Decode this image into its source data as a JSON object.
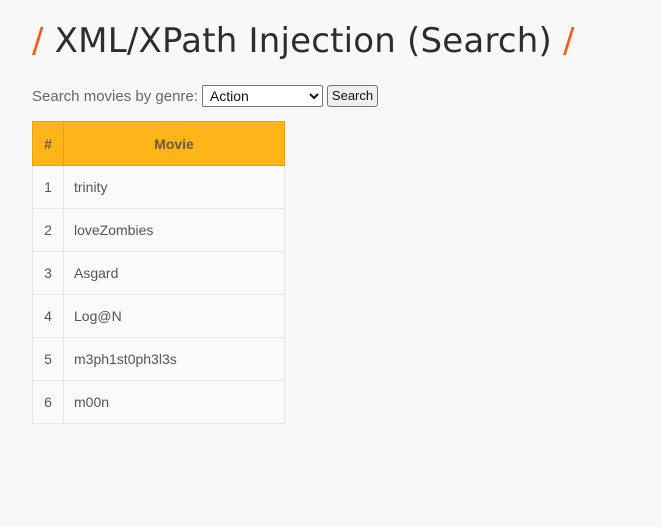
{
  "header": {
    "title": "XML/XPath Injection (Search)",
    "slash": "/"
  },
  "search": {
    "label": "Search movies by genre:",
    "selected_genre": "Action",
    "button_label": "Search"
  },
  "table": {
    "headers": [
      "#",
      "Movie"
    ],
    "rows": [
      {
        "index": "1",
        "movie": "trinity"
      },
      {
        "index": "2",
        "movie": "loveZombies"
      },
      {
        "index": "3",
        "movie": "Asgard"
      },
      {
        "index": "4",
        "movie": "Log@N"
      },
      {
        "index": "5",
        "movie": "m3ph1st0ph3l3s"
      },
      {
        "index": "6",
        "movie": "m00n"
      }
    ]
  },
  "colors": {
    "accent_slash": "#ff5b16",
    "table_header": "#ffb519",
    "background": "#f8f8f8"
  }
}
